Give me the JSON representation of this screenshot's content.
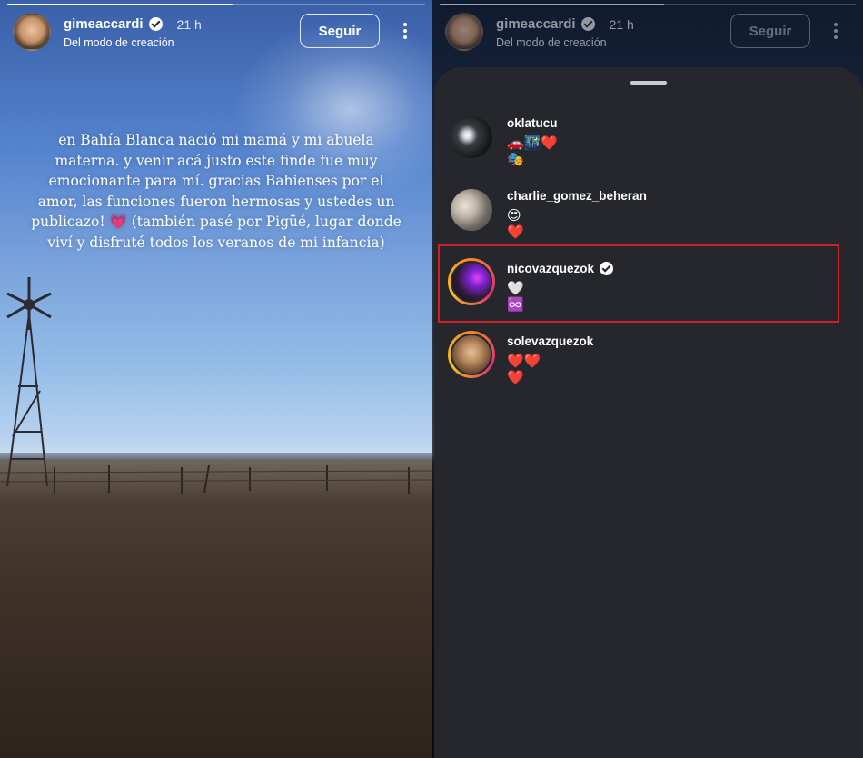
{
  "story": {
    "username": "gimeaccardi",
    "time": "21 h",
    "subtitle": "Del modo de creación",
    "follow_label": "Seguir",
    "progress": 0.54,
    "caption": "en Bahía Blanca nació mi mamá y mi abuela materna. y venir acá justo este finde fue muy emocionante para mí. gracias Bahienses por el amor, las funciones fueron hermosas y ustedes un publicazo! 💗 (también pasé por Pigüé, lugar donde viví y disfruté todos los veranos de mi infancia)"
  },
  "reactions": [
    {
      "username": "oklatucu",
      "verified": false,
      "line1": "🚗🌃❤️",
      "line2": "🎭",
      "avatar_color": "#1b1b1e"
    },
    {
      "username": "charlie_gomez_beheran",
      "verified": false,
      "line1": "😍",
      "line2": "❤️",
      "avatar_color": "#6f6a63"
    },
    {
      "username": "nicovazquezok",
      "verified": true,
      "line1": "🤍",
      "line2": "♾️",
      "avatar_color": "#3b2340",
      "highlighted": true
    },
    {
      "username": "solevazquezok",
      "verified": false,
      "line1": "❤️❤️",
      "line2": "❤️",
      "avatar_color": "#7a5a3f"
    }
  ],
  "colors": {
    "sheet": "#25272c",
    "highlight_border": "#d21f26"
  },
  "icons": [
    "verified-icon",
    "more-options-icon",
    "sheet-handle"
  ]
}
